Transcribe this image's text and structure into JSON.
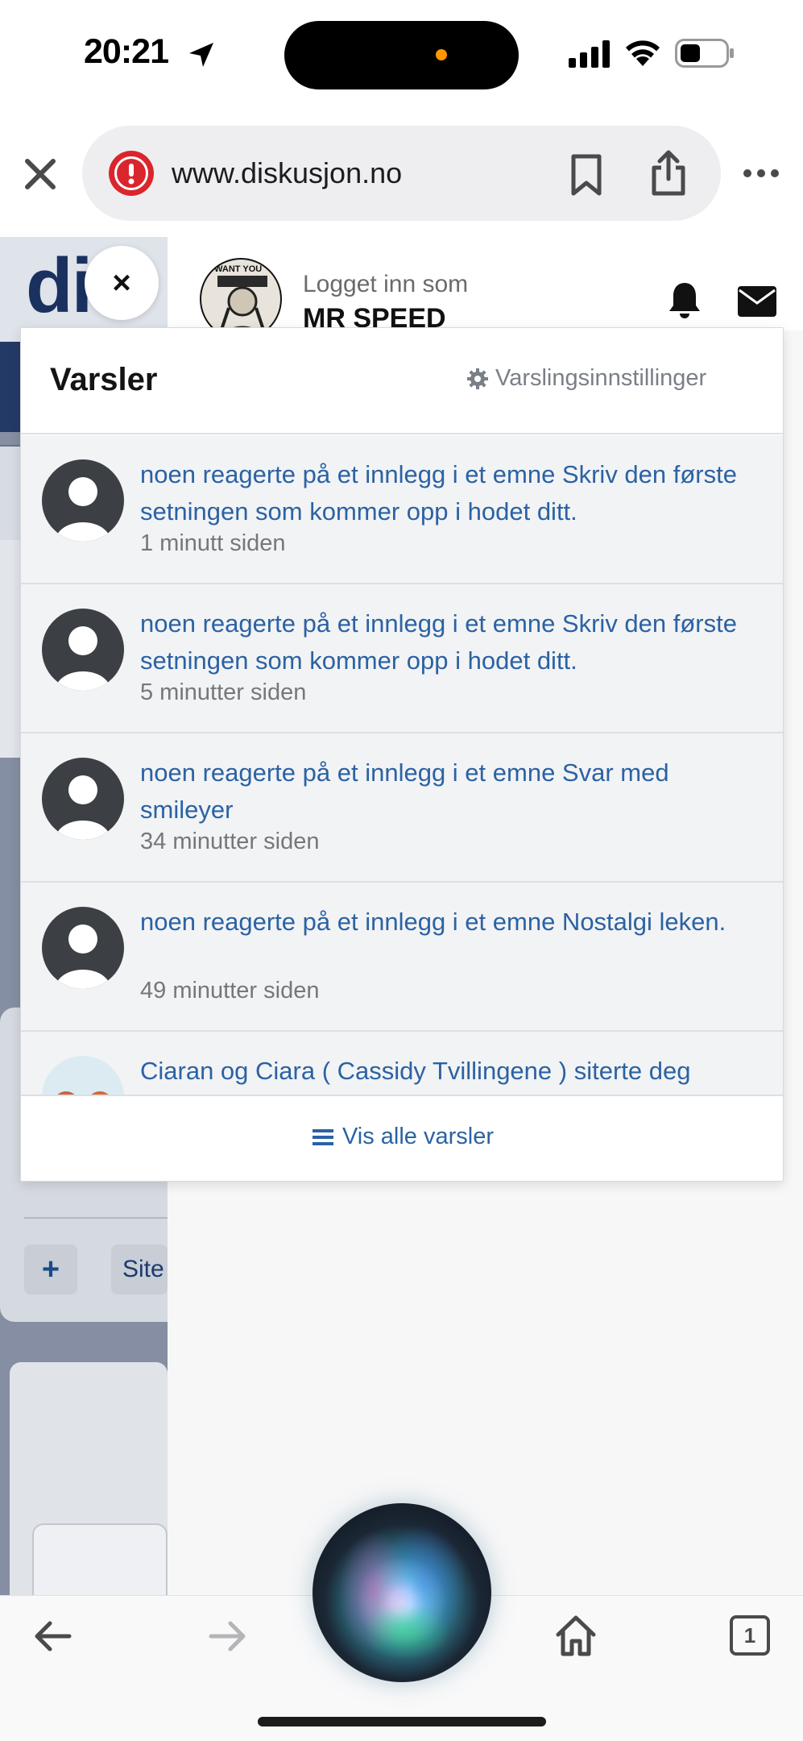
{
  "status_bar": {
    "time": "20:21",
    "icons": [
      "location-arrow-icon",
      "cellular-signal-icon",
      "wifi-icon",
      "battery-icon"
    ]
  },
  "browser": {
    "url": "www.diskusjon.no",
    "icons": [
      "close-icon",
      "warning-icon",
      "bookmark-icon",
      "share-icon",
      "more-icon"
    ]
  },
  "page": {
    "logo_text": "dis",
    "logged_in_label": "Logget inn som",
    "username": "MR SPEED",
    "avatar_caption": "I WANT YOU",
    "plus_label": "+",
    "site_label": "Site",
    "overlay_close": "×"
  },
  "notifications": {
    "title": "Varsler",
    "settings_label": "Varslingsinnstillinger",
    "items": [
      {
        "text": "noen reagerte på et innlegg i et emne Skriv den første setningen som kommer opp i hodet ditt.",
        "time": "1 minutt siden"
      },
      {
        "text": "noen reagerte på et innlegg i et emne Skriv den første setningen som kommer opp i hodet ditt.",
        "time": "5 minutter siden"
      },
      {
        "text": "noen reagerte på et innlegg i et emne Svar med smileyer",
        "time": "34 minutter siden"
      },
      {
        "text": "noen reagerte på et innlegg i et emne Nostalgi leken.",
        "time": "49 minutter siden"
      },
      {
        "text": "Ciaran og Ciara ( Cassidy Tvillingene ) siterte deg",
        "time": ""
      }
    ],
    "view_all_label": "Vis alle varsler"
  },
  "bottom_bar": {
    "tab_count": "1",
    "icons": [
      "back-arrow-icon",
      "forward-arrow-icon",
      "siri-icon",
      "home-icon",
      "tabs-icon"
    ]
  },
  "colors": {
    "link_blue": "#2b62a3",
    "brand_navy": "#1a3160",
    "warning_red": "#d9262c",
    "siri_teal": "#6fd0d6"
  }
}
